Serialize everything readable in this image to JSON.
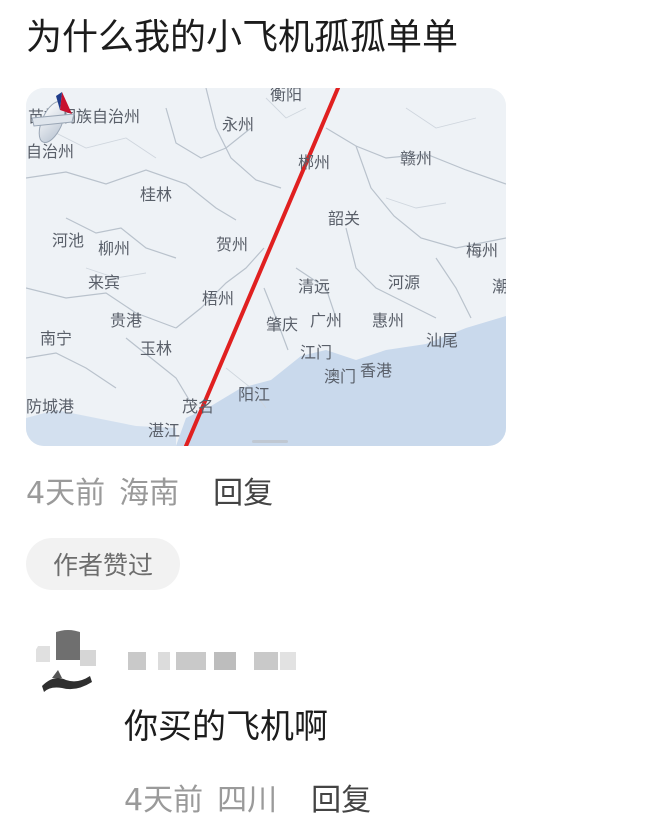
{
  "comment": {
    "text": "为什么我的小飞机孤孤单单",
    "map": {
      "cities": [
        "衡阳",
        "苗族侗族自治州",
        "永州",
        "自治州",
        "郴州",
        "赣州",
        "桂林",
        "韶关",
        "河池",
        "柳州",
        "贺州",
        "梅州",
        "来宾",
        "梧州",
        "清远",
        "河源",
        "潮",
        "贵港",
        "肇庆",
        "广州",
        "惠州",
        "南宁",
        "玉林",
        "江门",
        "汕尾",
        "澳门",
        "香港",
        "防城港",
        "茂名",
        "阳江",
        "湛江"
      ]
    },
    "time": "4天前",
    "location": "海南",
    "reply_label": "回复",
    "liked_badge": "作者赞过"
  },
  "reply": {
    "text": "你买的飞机啊",
    "time": "4天前",
    "location": "四川",
    "reply_label": "回复"
  },
  "colors": {
    "route_line": "#e02020",
    "muted_text": "#9a9a9a",
    "badge_bg": "#f2f2f2"
  }
}
